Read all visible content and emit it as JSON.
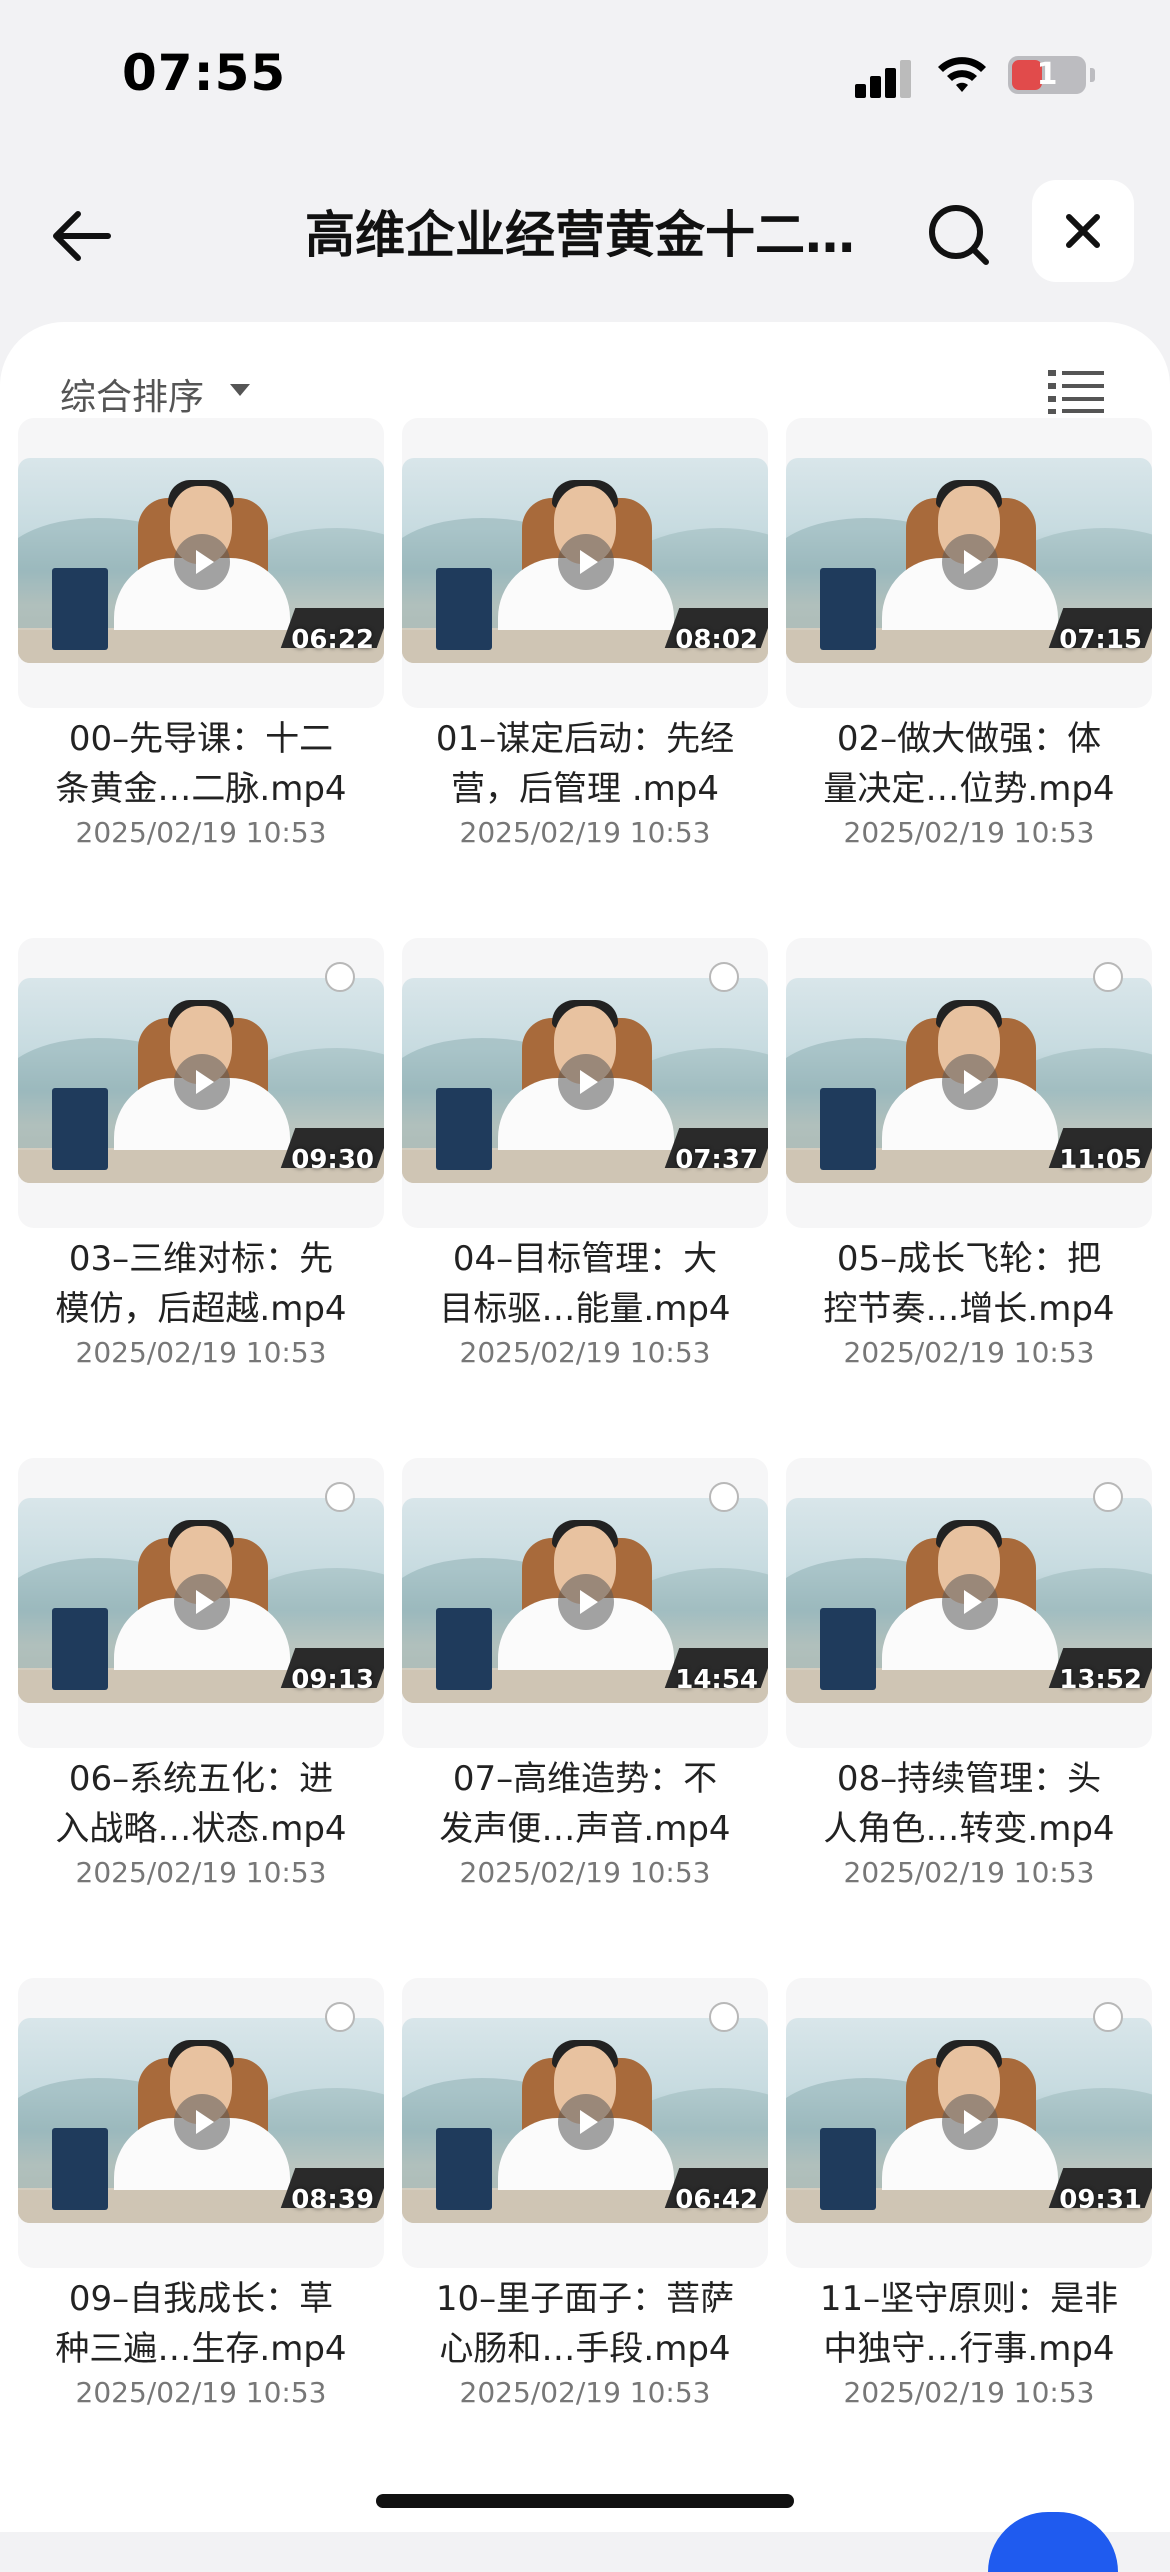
{
  "status_bar": {
    "time": "07:55",
    "battery": "1"
  },
  "nav": {
    "title": "高维企业经营黄金十二…"
  },
  "sort": {
    "label": "综合排序"
  },
  "colors": {
    "accent": "#1f5bef",
    "background": "#f2f2f4"
  },
  "icons": [
    "back-arrow-icon",
    "search-icon",
    "close-icon",
    "caret-down-icon",
    "list-view-icon",
    "play-icon",
    "signal-icon",
    "wifi-icon",
    "battery-icon"
  ],
  "videos": [
    {
      "name": "00–先导课：十二条黄金…二脉.mp4",
      "line1": "00–先导课：十二",
      "line2": "条黄金…二脉.mp4",
      "date": "2025/02/19 10:53",
      "duration": "06:22"
    },
    {
      "name": "01–谋定后动：先经营，后管理 .mp4",
      "line1": "01–谋定后动：先经",
      "line2": "营，后管理 .mp4",
      "date": "2025/02/19 10:53",
      "duration": "08:02"
    },
    {
      "name": "02–做大做强：体量决定…位势.mp4",
      "line1": "02–做大做强：体",
      "line2": "量决定…位势.mp4",
      "date": "2025/02/19 10:53",
      "duration": "07:15"
    },
    {
      "name": "03–三维对标：先模仿，后超越.mp4",
      "line1": "03–三维对标：先",
      "line2": "模仿，后超越.mp4",
      "date": "2025/02/19 10:53",
      "duration": "09:30"
    },
    {
      "name": "04–目标管理：大目标驱…能量.mp4",
      "line1": "04–目标管理：大",
      "line2": "目标驱…能量.mp4",
      "date": "2025/02/19 10:53",
      "duration": "07:37"
    },
    {
      "name": "05–成长飞轮：把控节奏…增长.mp4",
      "line1": "05–成长飞轮：把",
      "line2": "控节奏…增长.mp4",
      "date": "2025/02/19 10:53",
      "duration": "11:05"
    },
    {
      "name": "06–系统五化：进入战略…状态.mp4",
      "line1": "06–系统五化：进",
      "line2": "入战略…状态.mp4",
      "date": "2025/02/19 10:53",
      "duration": "09:13"
    },
    {
      "name": "07–高维造势：不发声便…声音.mp4",
      "line1": "07–高维造势：不",
      "line2": "发声便…声音.mp4",
      "date": "2025/02/19 10:53",
      "duration": "14:54"
    },
    {
      "name": "08–持续管理：头人角色…转变.mp4",
      "line1": "08–持续管理：头",
      "line2": "人角色…转变.mp4",
      "date": "2025/02/19 10:53",
      "duration": "13:52"
    },
    {
      "name": "09–自我成长：草种三遍…生存.mp4",
      "line1": "09–自我成长：草",
      "line2": "种三遍…生存.mp4",
      "date": "2025/02/19 10:53",
      "duration": "08:39"
    },
    {
      "name": "10–里子面子：菩萨心肠和…手段.mp4",
      "line1": "10–里子面子：菩萨",
      "line2": "心肠和…手段.mp4",
      "date": "2025/02/19 10:53",
      "duration": "06:42"
    },
    {
      "name": "11–坚守原则：是非中独守…行事.mp4",
      "line1": "11–坚守原则：是非",
      "line2": "中独守…行事.mp4",
      "date": "2025/02/19 10:53",
      "duration": "09:31"
    }
  ]
}
